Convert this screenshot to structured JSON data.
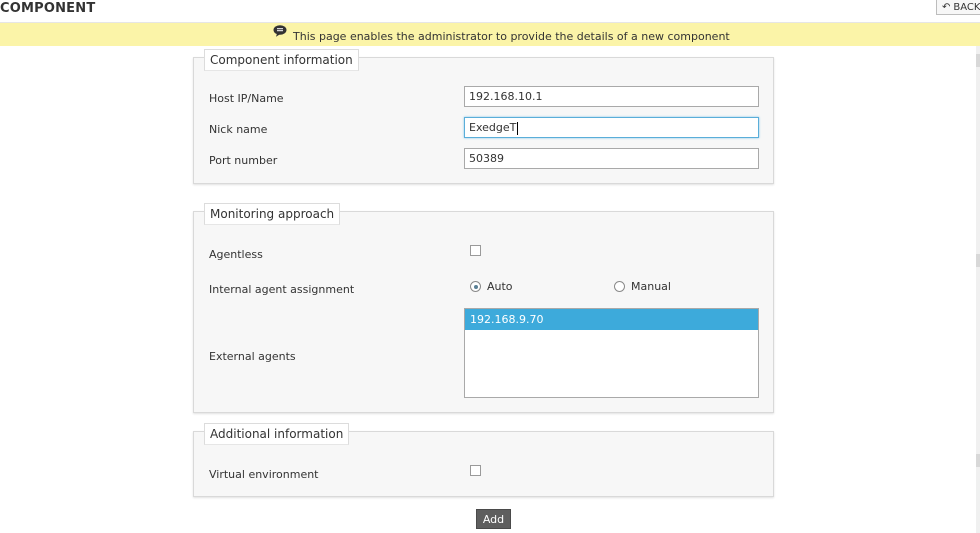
{
  "page": {
    "title": "COMPONENT",
    "back_label": "BACK"
  },
  "banner": {
    "icon": "speech-bubble-icon",
    "text": "This page enables the administrator to provide the details of a new component"
  },
  "component_info": {
    "legend": "Component information",
    "host": {
      "label": "Host IP/Name",
      "value": "192.168.10.1"
    },
    "nick": {
      "label": "Nick name",
      "value": "ExedgeT"
    },
    "port": {
      "label": "Port number",
      "value": "50389"
    }
  },
  "monitoring": {
    "legend": "Monitoring approach",
    "agentless": {
      "label": "Agentless",
      "checked": false
    },
    "internal": {
      "label": "Internal agent assignment",
      "options": [
        {
          "label": "Auto",
          "checked": true
        },
        {
          "label": "Manual",
          "checked": false
        }
      ]
    },
    "external": {
      "label": "External agents",
      "items": [
        "192.168.9.70"
      ],
      "selected": "192.168.9.70"
    }
  },
  "additional": {
    "legend": "Additional information",
    "virtual": {
      "label": "Virtual environment",
      "checked": false
    }
  },
  "actions": {
    "add_label": "Add"
  },
  "colors": {
    "banner": "#fbf4a8",
    "selection": "#3daadb",
    "button": "#5e5e5e"
  }
}
